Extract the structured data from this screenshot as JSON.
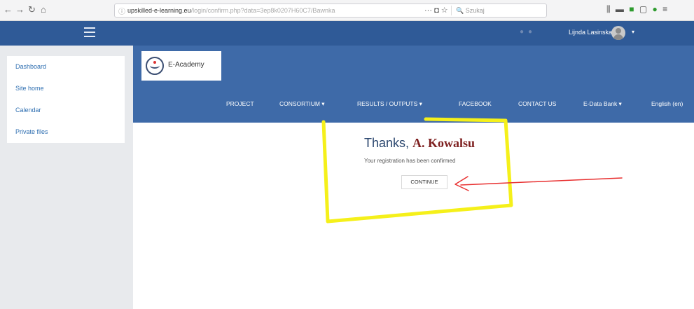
{
  "browser": {
    "back_icon": "arrow-left-icon",
    "url_host": "upskilled-e-learning.eu",
    "url_path": "/login/confirm.php?data=3ep8k0207H60C7/Bawnka",
    "menu_dots": "···",
    "search_placeholder": "Szukaj"
  },
  "topbar": {
    "user_name": "Lijnda Lasinska",
    "caret": "▾"
  },
  "drawer": {
    "items": [
      {
        "label": "Dashboard"
      },
      {
        "label": "Site home"
      },
      {
        "label": "Calendar"
      },
      {
        "label": "Private files"
      }
    ]
  },
  "header": {
    "logo_text": "E-Academy",
    "nav": [
      {
        "label": "PROJECT"
      },
      {
        "label": "CONSORTIUM ▾"
      },
      {
        "label": "RESULTS / OUTPUTS ▾"
      },
      {
        "label": "FACEBOOK"
      },
      {
        "label": "CONTACT US"
      },
      {
        "label": "E-Data Bank ▾"
      },
      {
        "label": "English (en)"
      }
    ]
  },
  "confirmation": {
    "thanks_prefix": "Thanks,",
    "name": "A. Kowalsu",
    "message": "Your registration has been confirmed",
    "continue_label": "CONTINUE"
  },
  "annotation_colors": {
    "highlight": "#f5f01a",
    "arrow": "#e83030"
  }
}
